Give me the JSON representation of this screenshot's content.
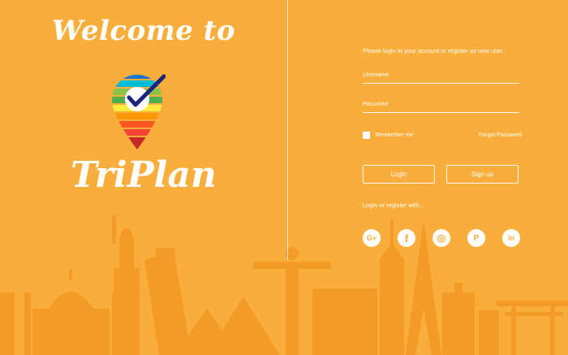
{
  "welcome": {
    "heading": "Welcome to",
    "brand": "TriPlan"
  },
  "login": {
    "subtitle": "Please login to your account or register as new user.",
    "username_placeholder": "Username",
    "password_placeholder": "Password",
    "remember_label": "Remember me",
    "forgot_label": "Forgot Password",
    "login_button": "Login",
    "signup_button": "Sign up",
    "social_prompt": "Login or register with..."
  },
  "social": {
    "google": "G+",
    "facebook": "f",
    "instagram": "◎",
    "pinterest": "P",
    "linkedin": "in"
  },
  "colors": {
    "background": "#f9ad3a",
    "skyline": "#f39a27",
    "text": "#ffffff",
    "logo_check": "#1a237e"
  }
}
